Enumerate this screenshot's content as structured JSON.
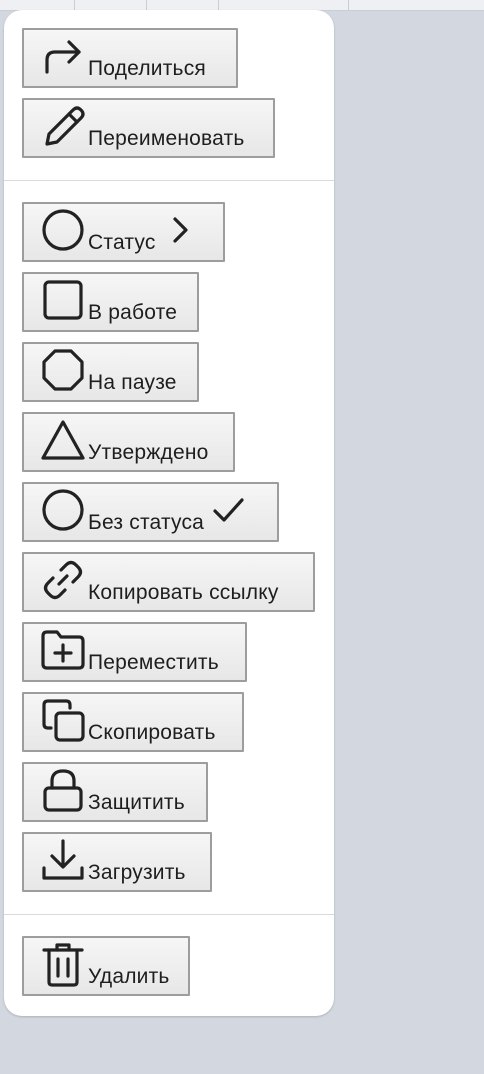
{
  "menu": {
    "items": [
      {
        "label": "Поделиться",
        "icon": "share-icon"
      },
      {
        "label": "Переименовать",
        "icon": "pencil-icon"
      },
      {
        "label": "Статус",
        "icon": "circle-icon",
        "trailing": "chevron-right-icon"
      },
      {
        "label": "В работе",
        "icon": "square-icon"
      },
      {
        "label": "На паузе",
        "icon": "octagon-icon"
      },
      {
        "label": "Утверждено",
        "icon": "triangle-icon"
      },
      {
        "label": "Без статуса",
        "icon": "circle-icon",
        "trailing": "checkmark-icon"
      },
      {
        "label": "Копировать ссылку",
        "icon": "link-icon"
      },
      {
        "label": "Переместить",
        "icon": "folder-plus-icon"
      },
      {
        "label": "Скопировать",
        "icon": "copy-icon"
      },
      {
        "label": "Защитить",
        "icon": "lock-icon"
      },
      {
        "label": "Загрузить",
        "icon": "download-icon"
      },
      {
        "label": "Удалить",
        "icon": "trash-icon"
      }
    ]
  },
  "colors": {
    "menu_background": "#ffffff",
    "button_border": "#9d9d9d",
    "text": "#1e1e1e",
    "backdrop": "#d3d7df"
  }
}
